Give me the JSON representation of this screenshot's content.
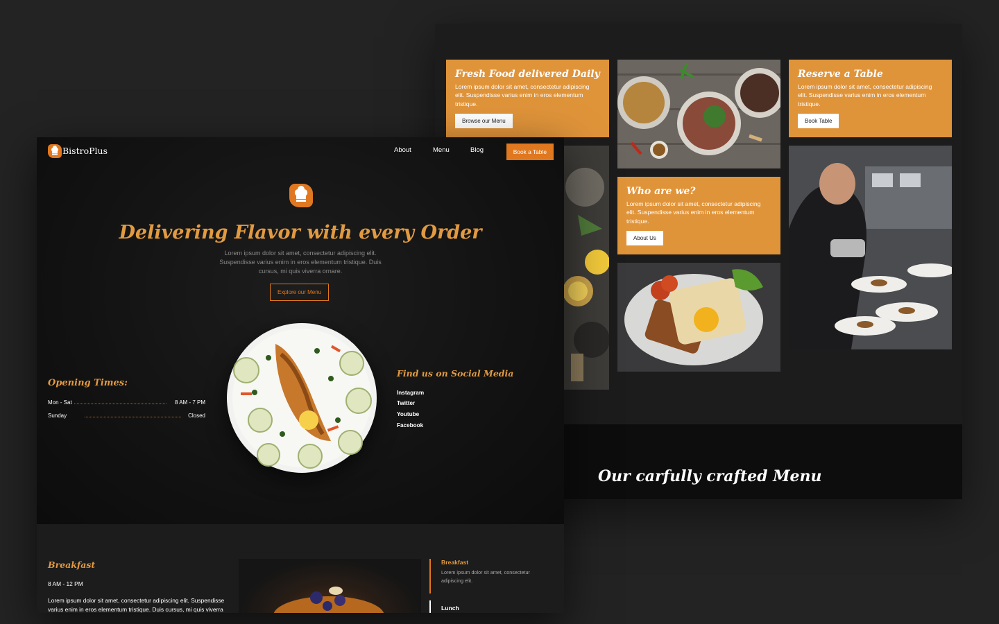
{
  "back": {
    "cards": [
      {
        "title": "Fresh Food delivered Daily",
        "text": "Lorem ipsum dolor sit amet, consectetur adipiscing elit. Suspendisse varius enim in eros elementum tristique.",
        "button": "Browse our Menu"
      },
      {
        "title": "Reserve a Table",
        "text": "Lorem ipsum dolor sit amet, consectetur adipiscing elit. Suspendisse varius enim in eros elementum tristique.",
        "button": "Book Table"
      },
      {
        "title": "Who are we?",
        "text": "Lorem ipsum dolor sit amet, consectetur adipiscing elit. Suspendisse varius enim in eros elementum tristique.",
        "button": "About Us"
      }
    ],
    "menu_heading": "Our carfully crafted Menu"
  },
  "front": {
    "nav": {
      "brand": "BistroPlus",
      "links": [
        "About",
        "Menu",
        "Blog"
      ],
      "cta": "Book a Table"
    },
    "hero": {
      "title": "Delivering Flavor with every Order",
      "subtitle": "Lorem ipsum dolor sit amet, consectetur adipiscing elit. Suspendisse varius enim in eros elementum tristique. Duis cursus, mi quis viverra ornare.",
      "button": "Explore our Menu"
    },
    "opening": {
      "title": "Opening Times:",
      "rows": [
        {
          "day": "Mon - Sat",
          "time": "8 AM - 7 PM"
        },
        {
          "day": "Sunday",
          "time": "Closed"
        }
      ]
    },
    "social": {
      "title": "Find us on Social Media",
      "links": [
        "Instagram",
        "Twitter",
        "Youtube",
        "Facebook"
      ]
    },
    "breakfast": {
      "title": "Breakfast",
      "time": "8 AM - 12 PM",
      "text": "Lorem ipsum dolor sit amet, consectetur adipiscing elit. Suspendisse varius enim in eros elementum tristique. Duis cursus, mi quis viverra"
    },
    "side_menu": [
      {
        "title": "Breakfast",
        "text": "Lorem ipsum dolor sit amet, consectetur adipiscing elit."
      },
      {
        "title": "Lunch",
        "text": ""
      }
    ]
  },
  "colors": {
    "accent": "#e0781f",
    "gold": "#e29a41",
    "card": "#e0943a",
    "background": "#232323"
  }
}
